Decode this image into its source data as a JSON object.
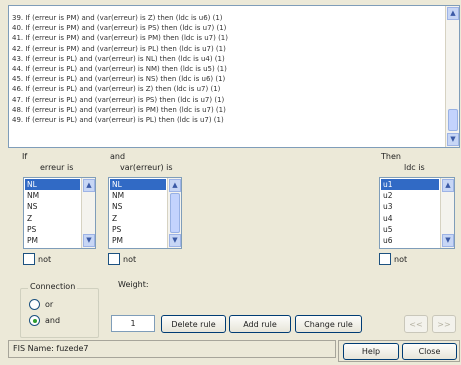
{
  "rules": [
    "39. If (erreur is PM) and (var(erreur) is Z) then (ldc is u6) (1)",
    "40. If (erreur is PM) and (var(erreur) is PS) then (ldc is u7) (1)",
    "41. If (erreur is PM) and (var(erreur) is PM) then (ldc is u7) (1)",
    "42. If (erreur is PM) and (var(erreur) is PL) then (ldc is u7) (1)",
    "43. If (erreur is PL) and (var(erreur) is NL) then (ldc is u4) (1)",
    "44. If (erreur is PL) and (var(erreur) is NM) then (ldc is u5) (1)",
    "45. If (erreur is PL) and (var(erreur) is NS) then (ldc is u6) (1)",
    "46. If (erreur is PL) and (var(erreur) is Z) then (ldc is u7) (1)",
    "47. If (erreur is PL) and (var(erreur) is PS) then (ldc is u7) (1)",
    "48. If (erreur is PL) and (var(erreur) is PM) then (ldc is u7) (1)",
    "49. If (erreur is PL) and (var(erreur) is PL) then (ldc is u7) (1)"
  ],
  "labels": {
    "if": "If",
    "erreur_is": "erreur is",
    "and": "and",
    "var_erreur_is": "var(erreur) is",
    "then": "Then",
    "ldc_is": "ldc is",
    "not": "not",
    "connection": "Connection",
    "or": "or",
    "and_option": "and",
    "weight": "Weight:"
  },
  "input1_items": [
    "NL",
    "NM",
    "NS",
    "Z",
    "PS",
    "PM"
  ],
  "input2_items": [
    "NL",
    "NM",
    "NS",
    "Z",
    "PS",
    "PM"
  ],
  "output_items": [
    "u1",
    "u2",
    "u3",
    "u4",
    "u5",
    "u6"
  ],
  "input1_selected": "NL",
  "input2_selected": "NL",
  "output_selected": "u1",
  "connection_selected": "and",
  "weight_value": "1",
  "buttons": {
    "delete": "Delete rule",
    "add": "Add rule",
    "change": "Change rule",
    "prev": "<<",
    "next": ">>",
    "help": "Help",
    "close": "Close"
  },
  "status": "FIS Name: fuzede7",
  "colors": {
    "selection": "#316ac5",
    "background": "#ece9d8",
    "radio_dot": "#2f9e2f"
  }
}
